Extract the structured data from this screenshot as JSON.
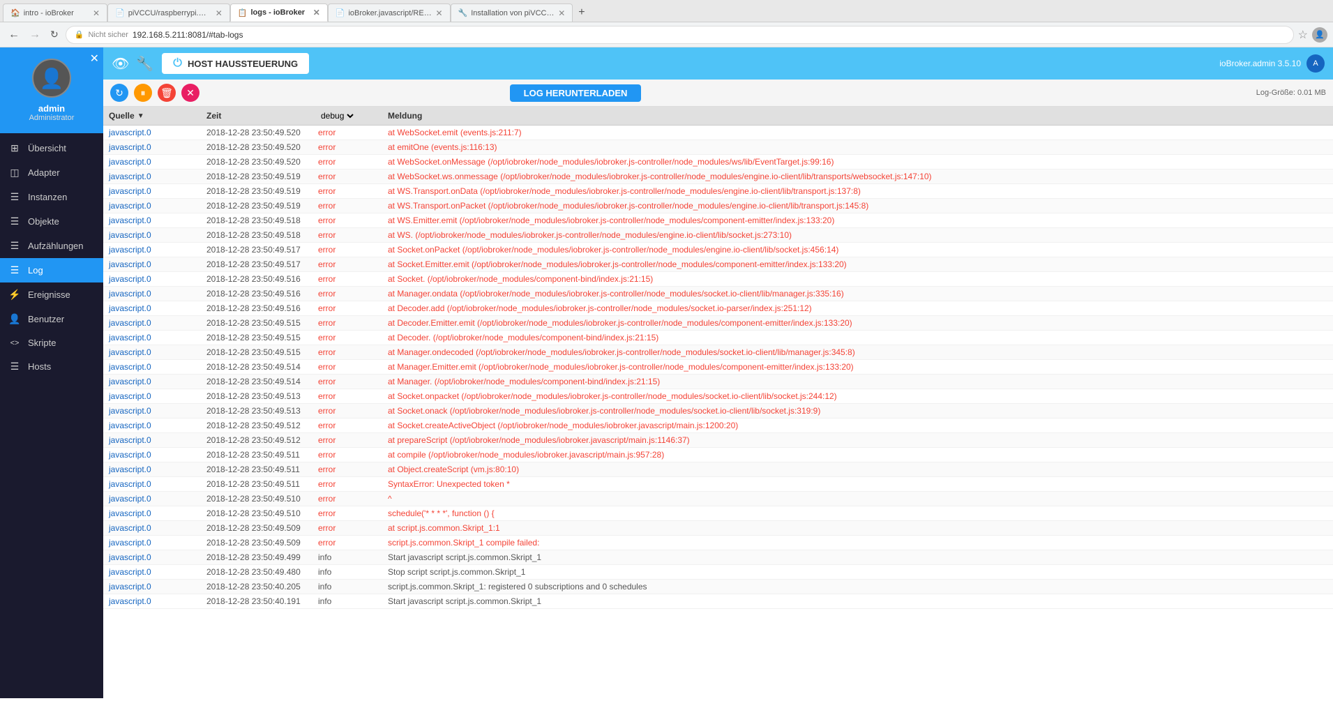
{
  "browser": {
    "tabs": [
      {
        "label": "intro - ioBroker",
        "active": false,
        "favicon": "🏠"
      },
      {
        "label": "piVCCU/raspberrypi.md at mast...",
        "active": false,
        "favicon": "📄"
      },
      {
        "label": "logs - ioBroker",
        "active": true,
        "favicon": "📋"
      },
      {
        "label": "ioBroker.javascript/README.md...",
        "active": false,
        "favicon": "📄"
      },
      {
        "label": "Installation von piVCCU fehlges...",
        "active": false,
        "favicon": "🔧"
      }
    ],
    "address": "192.168.5.211:8081/#tab-logs",
    "protocol": "Nicht sicher"
  },
  "topbar": {
    "host_label": "HOST HAUSSTEUERUNG",
    "user_label": "ioBroker.admin 3.5.10"
  },
  "sidebar": {
    "username": "admin",
    "role": "Administrator",
    "items": [
      {
        "label": "Übersicht",
        "icon": "⊞",
        "active": false
      },
      {
        "label": "Adapter",
        "icon": "◫",
        "active": false
      },
      {
        "label": "Instanzen",
        "icon": "☰",
        "active": false
      },
      {
        "label": "Objekte",
        "icon": "☰",
        "active": false
      },
      {
        "label": "Aufzählungen",
        "icon": "☰",
        "active": false
      },
      {
        "label": "Log",
        "icon": "☰",
        "active": true
      },
      {
        "label": "Ereignisse",
        "icon": "⚡",
        "active": false
      },
      {
        "label": "Benutzer",
        "icon": "👤",
        "active": false
      },
      {
        "label": "Skripte",
        "icon": "<>",
        "active": false
      },
      {
        "label": "Hosts",
        "icon": "☰",
        "active": false
      }
    ]
  },
  "log": {
    "download_btn": "LOG HERUNTERLADEN",
    "log_size_label": "Log-Größe: 0.01 MB",
    "columns": {
      "source": "Quelle",
      "time": "Zeit",
      "level": "debug",
      "message": "Meldung"
    },
    "rows": [
      {
        "source": "javascript.0",
        "time": "2018-12-28 23:50:49.520",
        "level": "error",
        "message": "at WebSocket.emit (events.js:211:7)"
      },
      {
        "source": "javascript.0",
        "time": "2018-12-28 23:50:49.520",
        "level": "error",
        "message": "at emitOne (events.js:116:13)"
      },
      {
        "source": "javascript.0",
        "time": "2018-12-28 23:50:49.520",
        "level": "error",
        "message": "at WebSocket.onMessage (/opt/iobroker/node_modules/iobroker.js-controller/node_modules/ws/lib/EventTarget.js:99:16)"
      },
      {
        "source": "javascript.0",
        "time": "2018-12-28 23:50:49.519",
        "level": "error",
        "message": "at WebSocket.ws.onmessage (/opt/iobroker/node_modules/iobroker.js-controller/node_modules/engine.io-client/lib/transports/websocket.js:147:10)"
      },
      {
        "source": "javascript.0",
        "time": "2018-12-28 23:50:49.519",
        "level": "error",
        "message": "at WS.Transport.onData (/opt/iobroker/node_modules/iobroker.js-controller/node_modules/engine.io-client/lib/transport.js:137:8)"
      },
      {
        "source": "javascript.0",
        "time": "2018-12-28 23:50:49.519",
        "level": "error",
        "message": "at WS.Transport.onPacket (/opt/iobroker/node_modules/iobroker.js-controller/node_modules/engine.io-client/lib/transport.js:145:8)"
      },
      {
        "source": "javascript.0",
        "time": "2018-12-28 23:50:49.518",
        "level": "error",
        "message": "at WS.Emitter.emit (/opt/iobroker/node_modules/iobroker.js-controller/node_modules/component-emitter/index.js:133:20)"
      },
      {
        "source": "javascript.0",
        "time": "2018-12-28 23:50:49.518",
        "level": "error",
        "message": "at WS.<anonymous> (/opt/iobroker/node_modules/iobroker.js-controller/node_modules/engine.io-client/lib/socket.js:273:10)"
      },
      {
        "source": "javascript.0",
        "time": "2018-12-28 23:50:49.517",
        "level": "error",
        "message": "at Socket.onPacket (/opt/iobroker/node_modules/iobroker.js-controller/node_modules/engine.io-client/lib/socket.js:456:14)"
      },
      {
        "source": "javascript.0",
        "time": "2018-12-28 23:50:49.517",
        "level": "error",
        "message": "at Socket.Emitter.emit (/opt/iobroker/node_modules/iobroker.js-controller/node_modules/component-emitter/index.js:133:20)"
      },
      {
        "source": "javascript.0",
        "time": "2018-12-28 23:50:49.516",
        "level": "error",
        "message": "at Socket.<anonymous> (/opt/iobroker/node_modules/component-bind/index.js:21:15)"
      },
      {
        "source": "javascript.0",
        "time": "2018-12-28 23:50:49.516",
        "level": "error",
        "message": "at Manager.ondata (/opt/iobroker/node_modules/iobroker.js-controller/node_modules/socket.io-client/lib/manager.js:335:16)"
      },
      {
        "source": "javascript.0",
        "time": "2018-12-28 23:50:49.516",
        "level": "error",
        "message": "at Decoder.add (/opt/iobroker/node_modules/iobroker.js-controller/node_modules/socket.io-parser/index.js:251:12)"
      },
      {
        "source": "javascript.0",
        "time": "2018-12-28 23:50:49.515",
        "level": "error",
        "message": "at Decoder.Emitter.emit (/opt/iobroker/node_modules/iobroker.js-controller/node_modules/component-emitter/index.js:133:20)"
      },
      {
        "source": "javascript.0",
        "time": "2018-12-28 23:50:49.515",
        "level": "error",
        "message": "at Decoder.<anonymous> (/opt/iobroker/node_modules/component-bind/index.js:21:15)"
      },
      {
        "source": "javascript.0",
        "time": "2018-12-28 23:50:49.515",
        "level": "error",
        "message": "at Manager.ondecoded (/opt/iobroker/node_modules/iobroker.js-controller/node_modules/socket.io-client/lib/manager.js:345:8)"
      },
      {
        "source": "javascript.0",
        "time": "2018-12-28 23:50:49.514",
        "level": "error",
        "message": "at Manager.Emitter.emit (/opt/iobroker/node_modules/iobroker.js-controller/node_modules/component-emitter/index.js:133:20)"
      },
      {
        "source": "javascript.0",
        "time": "2018-12-28 23:50:49.514",
        "level": "error",
        "message": "at Manager.<anonymous> (/opt/iobroker/node_modules/component-bind/index.js:21:15)"
      },
      {
        "source": "javascript.0",
        "time": "2018-12-28 23:50:49.513",
        "level": "error",
        "message": "at Socket.onpacket (/opt/iobroker/node_modules/iobroker.js-controller/node_modules/socket.io-client/lib/socket.js:244:12)"
      },
      {
        "source": "javascript.0",
        "time": "2018-12-28 23:50:49.513",
        "level": "error",
        "message": "at Socket.onack (/opt/iobroker/node_modules/iobroker.js-controller/node_modules/socket.io-client/lib/socket.js:319:9)"
      },
      {
        "source": "javascript.0",
        "time": "2018-12-28 23:50:49.512",
        "level": "error",
        "message": "at Socket.createActiveObject (/opt/iobroker/node_modules/iobroker.javascript/main.js:1200:20)"
      },
      {
        "source": "javascript.0",
        "time": "2018-12-28 23:50:49.512",
        "level": "error",
        "message": "at prepareScript (/opt/iobroker/node_modules/iobroker.javascript/main.js:1146:37)"
      },
      {
        "source": "javascript.0",
        "time": "2018-12-28 23:50:49.511",
        "level": "error",
        "message": "at compile (/opt/iobroker/node_modules/iobroker.javascript/main.js:957:28)"
      },
      {
        "source": "javascript.0",
        "time": "2018-12-28 23:50:49.511",
        "level": "error",
        "message": "at Object.createScript (vm.js:80:10)"
      },
      {
        "source": "javascript.0",
        "time": "2018-12-28 23:50:49.511",
        "level": "error",
        "message": "SyntaxError: Unexpected token *"
      },
      {
        "source": "javascript.0",
        "time": "2018-12-28 23:50:49.510",
        "level": "error",
        "message": "^"
      },
      {
        "source": "javascript.0",
        "time": "2018-12-28 23:50:49.510",
        "level": "error",
        "message": "schedule('* * * *', function () {"
      },
      {
        "source": "javascript.0",
        "time": "2018-12-28 23:50:49.509",
        "level": "error",
        "message": "at script.js.common.Skript_1:1"
      },
      {
        "source": "javascript.0",
        "time": "2018-12-28 23:50:49.509",
        "level": "error",
        "message": "script.js.common.Skript_1 compile failed:"
      },
      {
        "source": "javascript.0",
        "time": "2018-12-28 23:50:49.499",
        "level": "info",
        "message": "Start javascript script.js.common.Skript_1"
      },
      {
        "source": "javascript.0",
        "time": "2018-12-28 23:50:49.480",
        "level": "info",
        "message": "Stop script script.js.common.Skript_1"
      },
      {
        "source": "javascript.0",
        "time": "2018-12-28 23:50:40.205",
        "level": "info",
        "message": "script.js.common.Skript_1: registered 0 subscriptions and 0 schedules"
      },
      {
        "source": "javascript.0",
        "time": "2018-12-28 23:50:40.191",
        "level": "info",
        "message": "Start javascript script.js.common.Skript_1"
      }
    ]
  }
}
